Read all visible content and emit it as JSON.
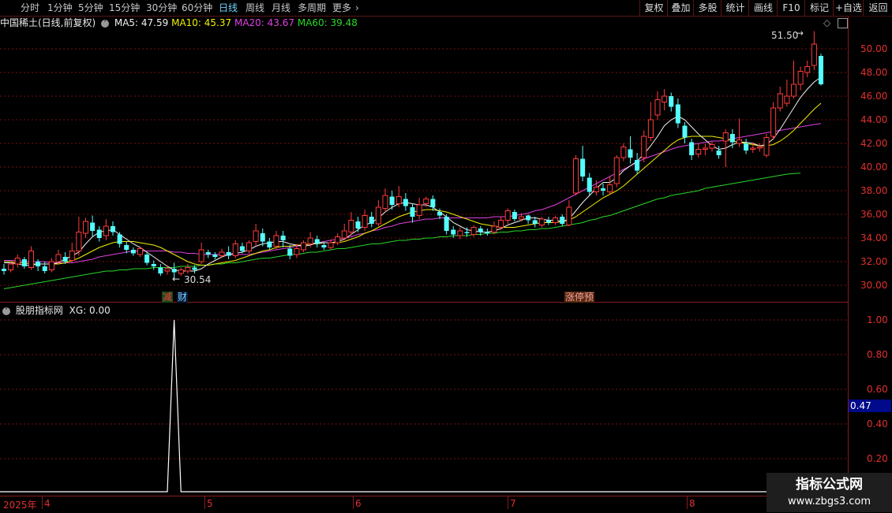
{
  "toolbar": {
    "periods": [
      {
        "label": "分时",
        "active": false
      },
      {
        "label": "1分钟",
        "active": false
      },
      {
        "label": "5分钟",
        "active": false
      },
      {
        "label": "15分钟",
        "active": false
      },
      {
        "label": "30分钟",
        "active": false
      },
      {
        "label": "60分钟",
        "active": false
      },
      {
        "label": "日线",
        "active": true
      },
      {
        "label": "周线",
        "active": false
      },
      {
        "label": "月线",
        "active": false
      },
      {
        "label": "多周期",
        "active": false
      },
      {
        "label": "更多",
        "active": false
      }
    ],
    "more_arrow": "›",
    "right_buttons": [
      "复权",
      "叠加",
      "多股",
      "统计",
      "画线",
      "F10",
      "标记",
      "+自选",
      "返回"
    ]
  },
  "main_chart": {
    "title": "中国稀土(日线,前复权)",
    "ma5_label": "MA5: 47.59",
    "ma10_label": "MA10: 45.37",
    "ma20_label": "MA20: 43.67",
    "ma60_label": "MA60: 39.48",
    "high_annotation": "51.50",
    "low_annotation": "30.54",
    "signals": [
      "减",
      "财",
      "涨停预"
    ],
    "price_ticks": [
      "50.00",
      "48.00",
      "46.00",
      "44.00",
      "42.00",
      "40.00",
      "38.00",
      "36.00",
      "34.00",
      "32.00",
      "30.00"
    ],
    "colors": {
      "up": "#ff3b3b",
      "down": "#54ffff",
      "ma5": "#f0f0f0",
      "ma10": "#f0f000",
      "ma20": "#e040e0",
      "ma60": "#28d828",
      "grid": "#7a1010"
    }
  },
  "indicator": {
    "title": "股朋指标网",
    "xg_label": "XG: 0.00",
    "ticks": [
      "1.00",
      "0.80",
      "0.60",
      "0.40",
      "0.20"
    ],
    "current_value": "0.47"
  },
  "date_axis": {
    "labels": [
      "2025年",
      "4",
      "5",
      "6",
      "7",
      "8"
    ]
  },
  "watermark": {
    "line1": "指标公式网",
    "line2": "www.zbgs3.com"
  },
  "chart_data": {
    "type": "candlestick",
    "title": "中国稀土(日线,前复权)",
    "ylim": [
      29.5,
      51.5
    ],
    "candles": [
      {
        "o": 31.4,
        "c": 31.2,
        "h": 31.8,
        "l": 30.9
      },
      {
        "o": 31.3,
        "c": 31.8,
        "h": 32.0,
        "l": 31.1
      },
      {
        "o": 31.8,
        "c": 32.3,
        "h": 32.6,
        "l": 31.5
      },
      {
        "o": 32.2,
        "c": 31.6,
        "h": 32.4,
        "l": 31.4
      },
      {
        "o": 31.5,
        "c": 32.9,
        "h": 33.3,
        "l": 31.3
      },
      {
        "o": 32.0,
        "c": 31.6,
        "h": 32.2,
        "l": 31.2
      },
      {
        "o": 31.6,
        "c": 31.2,
        "h": 32.0,
        "l": 31.0
      },
      {
        "o": 31.3,
        "c": 32.0,
        "h": 32.3,
        "l": 31.1
      },
      {
        "o": 32.0,
        "c": 32.6,
        "h": 33.0,
        "l": 31.8
      },
      {
        "o": 32.4,
        "c": 32.0,
        "h": 32.8,
        "l": 31.8
      },
      {
        "o": 32.1,
        "c": 32.9,
        "h": 33.6,
        "l": 31.9
      },
      {
        "o": 32.9,
        "c": 34.5,
        "h": 35.8,
        "l": 32.5
      },
      {
        "o": 34.4,
        "c": 35.4,
        "h": 35.7,
        "l": 34.0
      },
      {
        "o": 35.3,
        "c": 34.6,
        "h": 35.9,
        "l": 34.1
      },
      {
        "o": 34.7,
        "c": 34.0,
        "h": 35.0,
        "l": 33.7
      },
      {
        "o": 34.2,
        "c": 35.0,
        "h": 35.6,
        "l": 33.8
      },
      {
        "o": 35.0,
        "c": 34.5,
        "h": 35.4,
        "l": 34.2
      },
      {
        "o": 34.3,
        "c": 33.5,
        "h": 34.5,
        "l": 33.2
      },
      {
        "o": 33.4,
        "c": 33.0,
        "h": 33.7,
        "l": 32.7
      },
      {
        "o": 33.0,
        "c": 32.7,
        "h": 33.2,
        "l": 32.5
      },
      {
        "o": 32.6,
        "c": 33.1,
        "h": 33.3,
        "l": 32.4
      },
      {
        "o": 32.6,
        "c": 31.9,
        "h": 32.8,
        "l": 31.7
      },
      {
        "o": 31.8,
        "c": 31.6,
        "h": 32.1,
        "l": 31.3
      },
      {
        "o": 31.5,
        "c": 31.0,
        "h": 31.8,
        "l": 30.8
      },
      {
        "o": 31.2,
        "c": 31.4,
        "h": 31.7,
        "l": 30.9
      },
      {
        "o": 31.4,
        "c": 31.1,
        "h": 31.9,
        "l": 30.5
      },
      {
        "o": 31.0,
        "c": 31.3,
        "h": 31.5,
        "l": 30.8
      },
      {
        "o": 31.2,
        "c": 31.5,
        "h": 31.8,
        "l": 31.0
      },
      {
        "o": 31.5,
        "c": 31.3,
        "h": 31.7,
        "l": 31.0
      },
      {
        "o": 32.0,
        "c": 33.0,
        "h": 33.6,
        "l": 31.8
      },
      {
        "o": 32.8,
        "c": 32.6,
        "h": 33.0,
        "l": 32.3
      },
      {
        "o": 32.6,
        "c": 32.4,
        "h": 32.8,
        "l": 32.2
      },
      {
        "o": 32.5,
        "c": 32.8,
        "h": 33.1,
        "l": 32.3
      },
      {
        "o": 32.8,
        "c": 32.5,
        "h": 33.3,
        "l": 32.2
      },
      {
        "o": 32.5,
        "c": 33.5,
        "h": 33.8,
        "l": 32.3
      },
      {
        "o": 33.3,
        "c": 32.9,
        "h": 33.6,
        "l": 32.7
      },
      {
        "o": 32.9,
        "c": 33.6,
        "h": 33.8,
        "l": 32.7
      },
      {
        "o": 33.7,
        "c": 34.6,
        "h": 35.2,
        "l": 33.3
      },
      {
        "o": 34.4,
        "c": 33.7,
        "h": 34.8,
        "l": 33.3
      },
      {
        "o": 33.7,
        "c": 33.2,
        "h": 34.0,
        "l": 33.0
      },
      {
        "o": 33.3,
        "c": 34.2,
        "h": 34.6,
        "l": 33.0
      },
      {
        "o": 34.2,
        "c": 33.8,
        "h": 34.6,
        "l": 33.2
      },
      {
        "o": 33.1,
        "c": 32.5,
        "h": 33.4,
        "l": 32.2
      },
      {
        "o": 32.6,
        "c": 33.1,
        "h": 33.5,
        "l": 32.3
      },
      {
        "o": 33.0,
        "c": 33.6,
        "h": 33.8,
        "l": 32.8
      },
      {
        "o": 33.5,
        "c": 34.0,
        "h": 34.5,
        "l": 33.2
      },
      {
        "o": 33.9,
        "c": 33.5,
        "h": 34.2,
        "l": 33.2
      },
      {
        "o": 33.4,
        "c": 33.2,
        "h": 33.7,
        "l": 33.0
      },
      {
        "o": 33.2,
        "c": 33.6,
        "h": 33.9,
        "l": 33.0
      },
      {
        "o": 33.6,
        "c": 34.1,
        "h": 34.4,
        "l": 33.4
      },
      {
        "o": 34.0,
        "c": 34.6,
        "h": 35.2,
        "l": 33.8
      },
      {
        "o": 34.5,
        "c": 35.5,
        "h": 36.2,
        "l": 34.2
      },
      {
        "o": 35.4,
        "c": 34.8,
        "h": 35.8,
        "l": 34.5
      },
      {
        "o": 34.9,
        "c": 35.9,
        "h": 36.4,
        "l": 34.6
      },
      {
        "o": 35.8,
        "c": 35.2,
        "h": 36.2,
        "l": 34.9
      },
      {
        "o": 35.2,
        "c": 36.6,
        "h": 37.2,
        "l": 35.0
      },
      {
        "o": 36.5,
        "c": 37.6,
        "h": 38.2,
        "l": 36.2
      },
      {
        "o": 37.5,
        "c": 36.8,
        "h": 38.0,
        "l": 36.4
      },
      {
        "o": 36.9,
        "c": 37.5,
        "h": 38.4,
        "l": 36.6
      },
      {
        "o": 37.3,
        "c": 36.7,
        "h": 37.8,
        "l": 36.3
      },
      {
        "o": 36.6,
        "c": 35.8,
        "h": 36.9,
        "l": 35.3
      },
      {
        "o": 35.9,
        "c": 36.8,
        "h": 37.4,
        "l": 35.6
      },
      {
        "o": 36.9,
        "c": 37.3,
        "h": 37.5,
        "l": 36.6
      },
      {
        "o": 37.3,
        "c": 36.6,
        "h": 37.6,
        "l": 36.3
      },
      {
        "o": 36.2,
        "c": 35.9,
        "h": 36.5,
        "l": 35.6
      },
      {
        "o": 35.8,
        "c": 34.6,
        "h": 36.0,
        "l": 34.3
      },
      {
        "o": 34.7,
        "c": 34.3,
        "h": 35.0,
        "l": 34.0
      },
      {
        "o": 34.2,
        "c": 34.6,
        "h": 34.9,
        "l": 33.9
      },
      {
        "o": 34.5,
        "c": 34.4,
        "h": 34.9,
        "l": 34.1
      },
      {
        "o": 34.3,
        "c": 34.9,
        "h": 35.1,
        "l": 34.1
      },
      {
        "o": 34.8,
        "c": 34.5,
        "h": 35.0,
        "l": 34.2
      },
      {
        "o": 34.5,
        "c": 34.4,
        "h": 34.8,
        "l": 34.2
      },
      {
        "o": 34.5,
        "c": 35.0,
        "h": 35.4,
        "l": 34.3
      },
      {
        "o": 34.9,
        "c": 35.5,
        "h": 35.8,
        "l": 34.7
      },
      {
        "o": 35.5,
        "c": 36.3,
        "h": 36.5,
        "l": 35.2
      },
      {
        "o": 36.2,
        "c": 35.6,
        "h": 36.4,
        "l": 35.4
      },
      {
        "o": 35.6,
        "c": 35.8,
        "h": 36.1,
        "l": 35.4
      },
      {
        "o": 35.9,
        "c": 35.5,
        "h": 36.0,
        "l": 35.2
      },
      {
        "o": 35.5,
        "c": 35.2,
        "h": 35.8,
        "l": 34.9
      },
      {
        "o": 35.1,
        "c": 35.6,
        "h": 35.8,
        "l": 34.9
      },
      {
        "o": 35.5,
        "c": 35.3,
        "h": 35.8,
        "l": 35.1
      },
      {
        "o": 35.3,
        "c": 35.7,
        "h": 35.9,
        "l": 35.1
      },
      {
        "o": 35.8,
        "c": 35.2,
        "h": 36.0,
        "l": 35.0
      },
      {
        "o": 35.1,
        "c": 36.6,
        "h": 37.2,
        "l": 35.0
      },
      {
        "o": 37.8,
        "c": 40.7,
        "h": 41.0,
        "l": 37.6
      },
      {
        "o": 40.7,
        "c": 39.2,
        "h": 41.8,
        "l": 38.8
      },
      {
        "o": 39.1,
        "c": 37.9,
        "h": 39.5,
        "l": 37.6
      },
      {
        "o": 37.9,
        "c": 38.3,
        "h": 38.9,
        "l": 37.6
      },
      {
        "o": 38.2,
        "c": 38.0,
        "h": 38.6,
        "l": 37.6
      },
      {
        "o": 37.9,
        "c": 38.5,
        "h": 39.2,
        "l": 37.7
      },
      {
        "o": 38.6,
        "c": 40.8,
        "h": 41.0,
        "l": 38.3
      },
      {
        "o": 40.8,
        "c": 41.7,
        "h": 42.0,
        "l": 40.5
      },
      {
        "o": 41.5,
        "c": 40.8,
        "h": 42.6,
        "l": 40.3
      },
      {
        "o": 40.6,
        "c": 39.7,
        "h": 41.2,
        "l": 39.4
      },
      {
        "o": 40.8,
        "c": 42.6,
        "h": 43.1,
        "l": 40.4
      },
      {
        "o": 42.5,
        "c": 44.0,
        "h": 45.5,
        "l": 42.2
      },
      {
        "o": 44.4,
        "c": 45.7,
        "h": 46.4,
        "l": 44.0
      },
      {
        "o": 45.5,
        "c": 46.0,
        "h": 46.6,
        "l": 44.8
      },
      {
        "o": 46.0,
        "c": 45.1,
        "h": 46.3,
        "l": 44.7
      },
      {
        "o": 45.3,
        "c": 43.7,
        "h": 45.8,
        "l": 43.3
      },
      {
        "o": 43.5,
        "c": 42.5,
        "h": 43.8,
        "l": 42.0
      },
      {
        "o": 42.1,
        "c": 41.0,
        "h": 42.4,
        "l": 40.6
      },
      {
        "o": 41.1,
        "c": 41.5,
        "h": 42.0,
        "l": 40.8
      },
      {
        "o": 41.5,
        "c": 41.6,
        "h": 42.0,
        "l": 41.0
      },
      {
        "o": 41.6,
        "c": 41.9,
        "h": 42.2,
        "l": 41.3
      },
      {
        "o": 41.4,
        "c": 41.0,
        "h": 41.8,
        "l": 40.7
      },
      {
        "o": 42.2,
        "c": 42.9,
        "h": 43.2,
        "l": 40.0
      },
      {
        "o": 42.8,
        "c": 42.1,
        "h": 43.2,
        "l": 41.6
      },
      {
        "o": 42.0,
        "c": 42.3,
        "h": 44.1,
        "l": 41.7
      },
      {
        "o": 42.0,
        "c": 41.4,
        "h": 42.4,
        "l": 41.1
      },
      {
        "o": 41.5,
        "c": 41.6,
        "h": 42.1,
        "l": 41.2
      },
      {
        "o": 41.6,
        "c": 41.7,
        "h": 42.0,
        "l": 41.3
      },
      {
        "o": 41.0,
        "c": 42.5,
        "h": 42.8,
        "l": 40.8
      },
      {
        "o": 42.6,
        "c": 45.0,
        "h": 45.5,
        "l": 42.3
      },
      {
        "o": 45.0,
        "c": 46.2,
        "h": 46.8,
        "l": 44.7
      },
      {
        "o": 45.4,
        "c": 46.0,
        "h": 47.4,
        "l": 45.1
      },
      {
        "o": 46.0,
        "c": 47.0,
        "h": 49.0,
        "l": 45.8
      },
      {
        "o": 47.0,
        "c": 48.1,
        "h": 48.5,
        "l": 46.5
      },
      {
        "o": 48.0,
        "c": 48.5,
        "h": 49.0,
        "l": 47.6
      },
      {
        "o": 48.6,
        "c": 50.4,
        "h": 51.5,
        "l": 48.2
      },
      {
        "o": 49.4,
        "c": 47.0,
        "h": 49.6,
        "l": 46.9
      }
    ],
    "ma5": [
      31.9,
      31.9,
      31.8,
      31.7,
      31.7,
      31.8,
      31.8,
      31.8,
      31.9,
      32.2,
      32.5,
      32.8,
      33.5,
      34.1,
      34.5,
      34.6,
      34.7,
      34.3,
      33.9,
      33.5,
      33.2,
      32.8,
      32.4,
      32.0,
      31.6,
      31.3,
      31.2,
      31.2,
      31.2,
      31.4,
      31.8,
      32.1,
      32.4,
      32.6,
      32.7,
      32.8,
      33.0,
      33.3,
      33.5,
      33.6,
      33.7,
      33.7,
      33.5,
      33.4,
      33.3,
      33.4,
      33.6,
      33.6,
      33.6,
      33.7,
      33.9,
      34.3,
      34.7,
      35.1,
      35.3,
      35.7,
      36.2,
      36.6,
      36.9,
      37.0,
      36.9,
      36.8,
      36.8,
      36.6,
      36.2,
      35.8,
      35.3,
      35.0,
      34.7,
      34.6,
      34.5,
      34.5,
      34.6,
      34.8,
      35.1,
      35.3,
      35.5,
      35.7,
      35.7,
      35.6,
      35.5,
      35.5,
      35.4,
      35.6,
      36.3,
      37.0,
      37.6,
      38.2,
      38.7,
      38.7,
      39.1,
      39.7,
      40.1,
      40.5,
      41.1,
      41.8,
      42.6,
      43.5,
      44.0,
      44.3,
      44.0,
      43.4,
      42.8,
      42.3,
      41.8,
      41.5,
      41.6,
      41.9,
      42.1,
      42.1,
      42.0,
      41.8,
      41.9,
      42.4,
      43.2,
      44.1,
      45.0,
      45.9,
      46.6,
      47.2,
      47.6
    ],
    "ma10": [
      32.0,
      32.0,
      31.9,
      31.9,
      31.8,
      31.8,
      31.8,
      31.8,
      31.8,
      31.9,
      32.1,
      32.3,
      32.6,
      32.9,
      33.2,
      33.4,
      33.6,
      33.7,
      33.7,
      33.7,
      33.6,
      33.5,
      33.4,
      33.2,
      32.9,
      32.6,
      32.3,
      32.0,
      31.8,
      31.7,
      31.7,
      31.8,
      31.9,
      32.0,
      32.1,
      32.3,
      32.5,
      32.7,
      32.9,
      33.0,
      33.2,
      33.3,
      33.3,
      33.4,
      33.4,
      33.5,
      33.5,
      33.6,
      33.6,
      33.6,
      33.7,
      33.9,
      34.1,
      34.4,
      34.6,
      34.9,
      35.2,
      35.5,
      35.8,
      36.0,
      36.2,
      36.3,
      36.4,
      36.4,
      36.3,
      36.2,
      36.0,
      35.8,
      35.6,
      35.4,
      35.2,
      35.1,
      35.0,
      34.9,
      34.9,
      34.9,
      35.0,
      35.1,
      35.2,
      35.3,
      35.3,
      35.3,
      35.4,
      35.5,
      35.8,
      36.2,
      36.6,
      37.0,
      37.4,
      37.7,
      38.0,
      38.4,
      38.9,
      39.4,
      39.9,
      40.4,
      40.9,
      41.4,
      41.9,
      42.3,
      42.5,
      42.6,
      42.6,
      42.6,
      42.6,
      42.5,
      42.4,
      42.2,
      42.1,
      42.0,
      41.9,
      41.8,
      41.8,
      41.9,
      42.2,
      42.6,
      43.1,
      43.7,
      44.3,
      44.9,
      45.4
    ],
    "ma20": [
      32.1,
      32.1,
      32.1,
      32.0,
      32.0,
      32.0,
      32.0,
      31.9,
      31.9,
      31.9,
      31.9,
      32.0,
      32.1,
      32.2,
      32.4,
      32.5,
      32.6,
      32.7,
      32.8,
      32.9,
      32.9,
      32.9,
      32.9,
      32.9,
      32.9,
      32.8,
      32.8,
      32.7,
      32.7,
      32.6,
      32.6,
      32.6,
      32.6,
      32.6,
      32.6,
      32.6,
      32.6,
      32.7,
      32.8,
      32.9,
      33.0,
      33.1,
      33.2,
      33.3,
      33.4,
      33.5,
      33.6,
      33.7,
      33.8,
      33.9,
      34.0,
      34.1,
      34.3,
      34.4,
      34.6,
      34.7,
      34.9,
      35.0,
      35.2,
      35.3,
      35.4,
      35.5,
      35.6,
      35.6,
      35.7,
      35.7,
      35.7,
      35.7,
      35.7,
      35.7,
      35.7,
      35.7,
      35.8,
      35.8,
      35.8,
      35.9,
      36.0,
      36.1,
      36.3,
      36.4,
      36.6,
      36.8,
      37.1,
      37.4,
      37.7,
      38.0,
      38.3,
      38.6,
      38.9,
      39.2,
      39.5,
      39.8,
      40.1,
      40.4,
      40.7,
      40.9,
      41.1,
      41.3,
      41.5,
      41.7,
      41.8,
      41.9,
      42.0,
      42.1,
      42.2,
      42.2,
      42.3,
      42.4,
      42.5,
      42.6,
      42.7,
      42.8,
      42.9,
      43.0,
      43.1,
      43.2,
      43.3,
      43.4,
      43.5,
      43.6,
      43.67
    ],
    "ma60": [
      29.7,
      29.8,
      29.9,
      30.0,
      30.1,
      30.2,
      30.3,
      30.4,
      30.5,
      30.6,
      30.7,
      30.8,
      30.9,
      31.0,
      31.1,
      31.2,
      31.2,
      31.3,
      31.3,
      31.4,
      31.4,
      31.4,
      31.5,
      31.5,
      31.5,
      31.5,
      31.6,
      31.6,
      31.6,
      31.7,
      31.7,
      31.8,
      31.8,
      31.9,
      31.9,
      32.0,
      32.1,
      32.2,
      32.3,
      32.3,
      32.4,
      32.5,
      32.6,
      32.6,
      32.7,
      32.8,
      32.8,
      32.9,
      33.0,
      33.1,
      33.1,
      33.2,
      33.3,
      33.4,
      33.5,
      33.5,
      33.6,
      33.7,
      33.8,
      33.8,
      33.9,
      33.9,
      34.0,
      34.0,
      34.1,
      34.1,
      34.2,
      34.2,
      34.2,
      34.3,
      34.3,
      34.4,
      34.4,
      34.5,
      34.5,
      34.6,
      34.6,
      34.7,
      34.7,
      34.8,
      34.8,
      34.9,
      35.0,
      35.1,
      35.2,
      35.3,
      35.5,
      35.6,
      35.8,
      35.9,
      36.1,
      36.3,
      36.5,
      36.7,
      36.9,
      37.1,
      37.3,
      37.4,
      37.6,
      37.7,
      37.8,
      37.9,
      38.0,
      38.2,
      38.3,
      38.4,
      38.5,
      38.6,
      38.7,
      38.8,
      38.9,
      39.0,
      39.1,
      39.2,
      39.3,
      39.4,
      39.45,
      39.48
    ]
  },
  "indicator_data": {
    "type": "line",
    "ylim": [
      0,
      1.05
    ],
    "spike_index": 25,
    "values_note": ""
  }
}
